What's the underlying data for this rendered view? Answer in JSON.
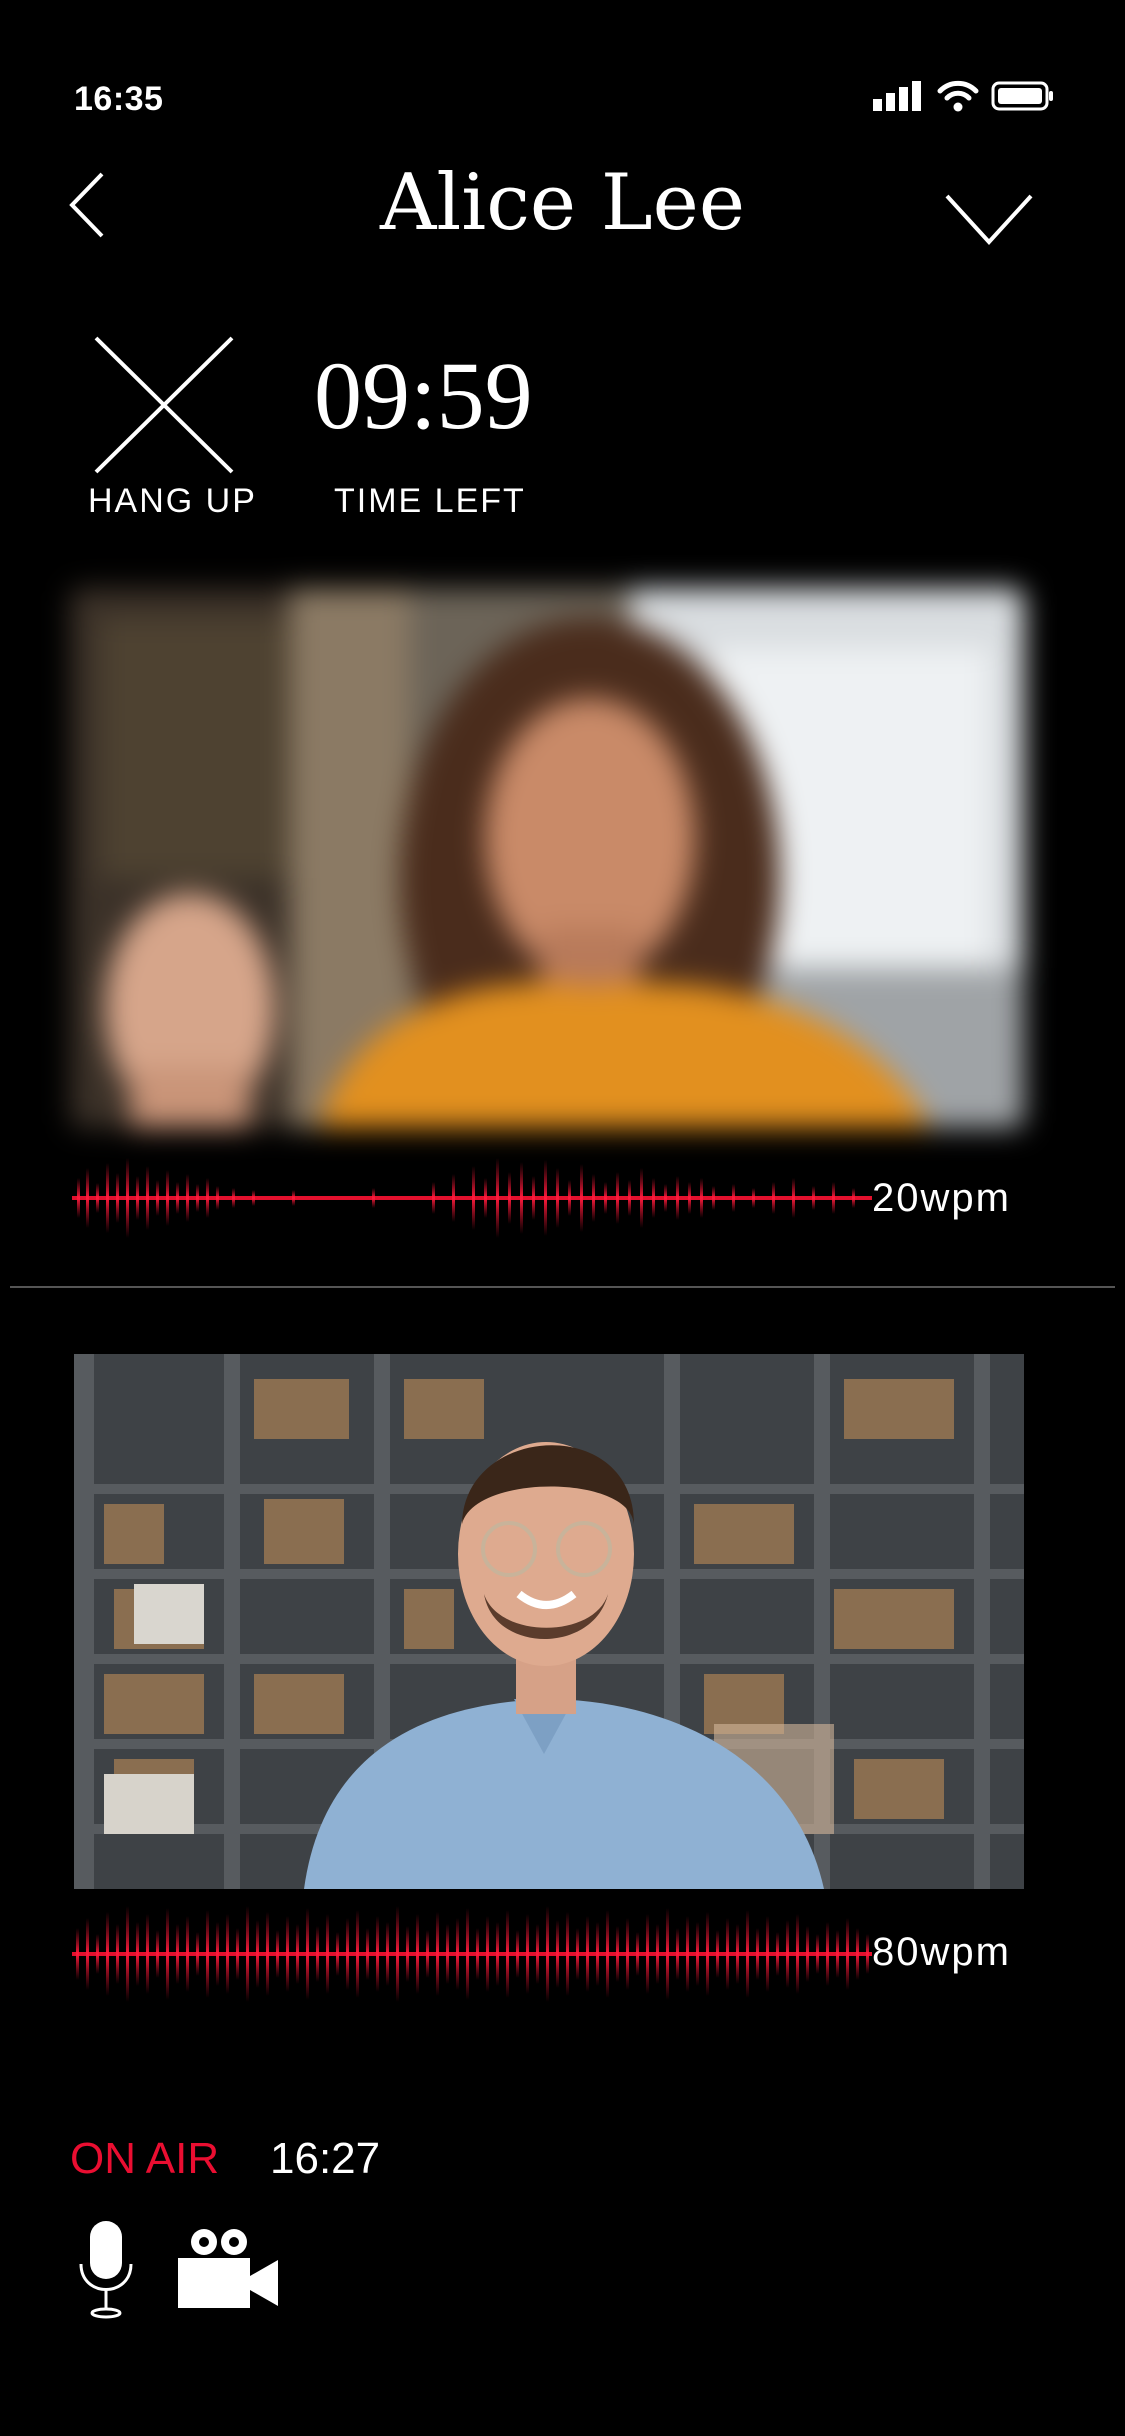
{
  "status": {
    "time": "16:35"
  },
  "header": {
    "title": "Alice Lee"
  },
  "call": {
    "hang_up_label": "HANG UP",
    "timer": "09:59",
    "timer_label": "TIME LEFT"
  },
  "remote": {
    "wpm": "20wpm"
  },
  "local": {
    "wpm": "80wpm"
  },
  "footer": {
    "on_air_label": "ON AIR",
    "on_air_time": "16:27"
  },
  "colors": {
    "accent": "#ea0e31",
    "background": "#000000",
    "waveform": "#e3102d"
  }
}
